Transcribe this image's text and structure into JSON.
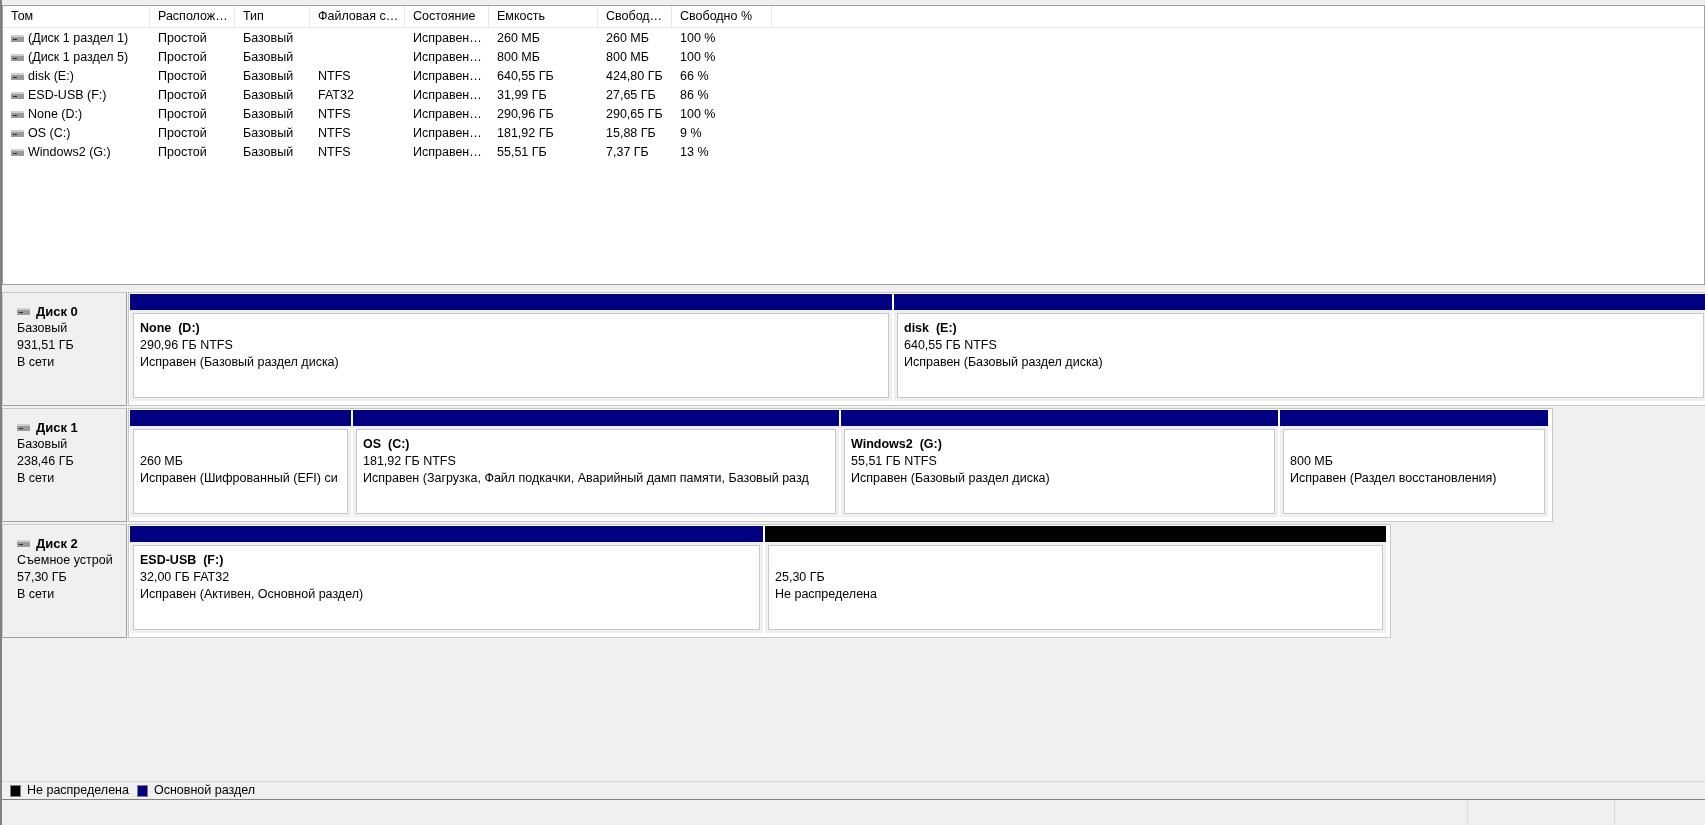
{
  "volume_table": {
    "columns": [
      "Том",
      "Располож…",
      "Тип",
      "Файловая с…",
      "Состояние",
      "Емкость",
      "Свобод…",
      "Свободно %"
    ],
    "rows": [
      [
        "(Диск 1 раздел 1)",
        "Простой",
        "Базовый",
        "",
        "Исправен…",
        "260 МБ",
        "260 МБ",
        "100 %"
      ],
      [
        "(Диск 1 раздел 5)",
        "Простой",
        "Базовый",
        "",
        "Исправен…",
        "800 МБ",
        "800 МБ",
        "100 %"
      ],
      [
        "disk (E:)",
        "Простой",
        "Базовый",
        "NTFS",
        "Исправен…",
        "640,55 ГБ",
        "424,80 ГБ",
        "66 %"
      ],
      [
        "ESD-USB (F:)",
        "Простой",
        "Базовый",
        "FAT32",
        "Исправен…",
        "31,99 ГБ",
        "27,65 ГБ",
        "86 %"
      ],
      [
        "None (D:)",
        "Простой",
        "Базовый",
        "NTFS",
        "Исправен…",
        "290,96 ГБ",
        "290,65 ГБ",
        "100 %"
      ],
      [
        "OS (C:)",
        "Простой",
        "Базовый",
        "NTFS",
        "Исправен…",
        "181,92 ГБ",
        "15,88 ГБ",
        "9 %"
      ],
      [
        "Windows2 (G:)",
        "Простой",
        "Базовый",
        "NTFS",
        "Исправен…",
        "55,51 ГБ",
        "7,37 ГБ",
        "13 %"
      ]
    ]
  },
  "disks": [
    {
      "name": "Диск 0",
      "type": "Базовый",
      "size": "931,51 ГБ",
      "status": "В сети",
      "partitions": [
        {
          "kind": "primary",
          "title": "None  (D:)",
          "size": "290,96 ГБ NTFS",
          "status": "Исправен (Базовый раздел диска)"
        },
        {
          "kind": "primary",
          "title": "disk  (E:)",
          "size": "640,55 ГБ NTFS",
          "status": "Исправен (Базовый раздел диска)"
        }
      ]
    },
    {
      "name": "Диск 1",
      "type": "Базовый",
      "size": "238,46 ГБ",
      "status": "В сети",
      "partitions": [
        {
          "kind": "primary",
          "size": "260 МБ",
          "status": "Исправен (Шифрованный (EFI) си"
        },
        {
          "kind": "primary",
          "title": "OS  (C:)",
          "size": "181,92 ГБ NTFS",
          "status": "Исправен (Загрузка, Файл подкачки, Аварийный дамп памяти, Базовый разд"
        },
        {
          "kind": "primary",
          "title": "Windows2  (G:)",
          "size": "55,51 ГБ NTFS",
          "status": "Исправен (Базовый раздел диска)"
        },
        {
          "kind": "primary",
          "size": "800 МБ",
          "status": "Исправен (Раздел восстановления)"
        }
      ]
    },
    {
      "name": "Диск 2",
      "type": "Съемное устрой",
      "size": "57,30 ГБ",
      "status": "В сети",
      "partitions": [
        {
          "kind": "primary",
          "title": "ESD-USB  (F:)",
          "size": "32,00 ГБ FAT32",
          "status": "Исправен (Активен, Основной раздел)"
        },
        {
          "kind": "unallocated",
          "size": "25,30 ГБ",
          "status": "Не распределена"
        }
      ]
    }
  ],
  "legend": [
    {
      "label": "Не распределена",
      "color": "#000000"
    },
    {
      "label": "Основной раздел",
      "color": "#000080"
    }
  ]
}
